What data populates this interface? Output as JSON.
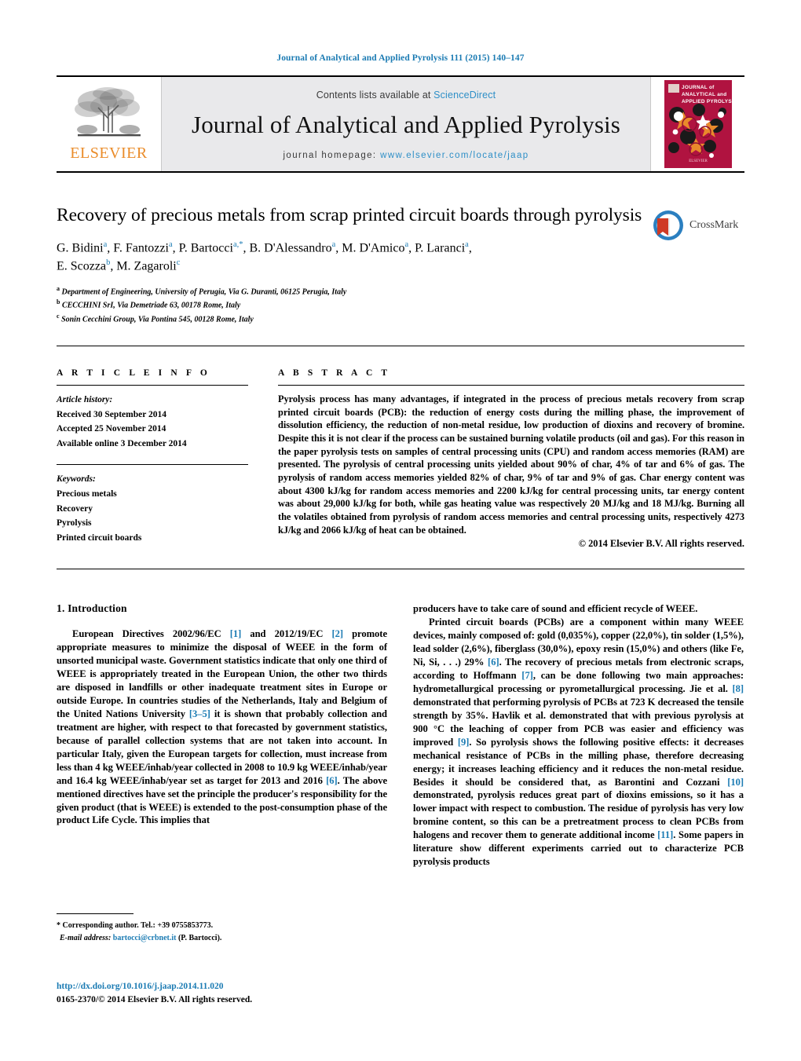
{
  "running_head": "Journal of Analytical and Applied Pyrolysis 111 (2015) 140–147",
  "masthead": {
    "publisher_logo_text": "ELSEVIER",
    "contents_prefix": "Contents lists available at ",
    "contents_link": "ScienceDirect",
    "journal_name": "Journal of Analytical and Applied Pyrolysis",
    "homepage_prefix": "journal homepage: ",
    "homepage_url": "www.elsevier.com/locate/jaap",
    "cover_title_line1": "JOURNAL of",
    "cover_title_line2": "ANALYTICAL and",
    "cover_title_line3": "APPLIED PYROLYSIS",
    "cover_footer": "ELSEVIER"
  },
  "article": {
    "title": "Recovery of precious metals from scrap printed circuit boards through pyrolysis",
    "authors_line1": "G. Bidini<sup>a</sup>, F. Fantozzi<sup>a</sup>, P. Bartocci<sup>a,*</sup>, B. D'Alessandro<sup>a</sup>, M. D'Amico<sup>a</sup>, P. Laranci<sup>a</sup>,",
    "authors_line2": "E. Scozza<sup>b</sup>, M. Zagaroli<sup>c</sup>",
    "affiliations": [
      "<sup>a</sup> Department of Engineering, University of Perugia, Via G. Duranti, 06125 Perugia, Italy",
      "<sup>b</sup> CECCHINI SrI, Via Demetriade 63, 00178 Rome, Italy",
      "<sup>c</sup> Sonin Cecchini Group, Via Pontina 545, 00128 Rome, Italy"
    ],
    "crossmark_label": "CrossMark"
  },
  "article_info": {
    "heading": "A R T I C L E   I N F O",
    "history_label": "Article history:",
    "history": [
      "Received 30 September 2014",
      "Accepted 25 November 2014",
      "Available online 3 December 2014"
    ],
    "keywords_label": "Keywords:",
    "keywords": [
      "Precious metals",
      "Recovery",
      "Pyrolysis",
      "Printed circuit boards"
    ]
  },
  "abstract": {
    "heading": "A B S T R A C T",
    "text": "Pyrolysis process has many advantages, if integrated in the process of precious metals recovery from scrap printed circuit boards (PCB): the reduction of energy costs during the milling phase, the improvement of dissolution efficiency, the reduction of non-metal residue, low production of dioxins and recovery of bromine. Despite this it is not clear if the process can be sustained burning volatile products (oil and gas). For this reason in the paper pyrolysis tests on samples of central processing units (CPU) and random access memories (RAM) are presented. The pyrolysis of central processing units yielded about 90% of char, 4% of tar and 6% of gas. The pyrolysis of random access memories yielded 82% of char, 9% of tar and 9% of gas. Char energy content was about 4300 kJ/kg for random access memories and 2200 kJ/kg for central processing units, tar energy content was about 29,000 kJ/kg for both, while gas heating value was respectively 20 MJ/kg and 18 MJ/kg. Burning all the volatiles obtained from pyrolysis of random access memories and central processing units, respectively 4273 kJ/kg and 2066 kJ/kg of heat can be obtained.",
    "copyright": "© 2014 Elsevier B.V. All rights reserved."
  },
  "body": {
    "section_heading": "1.  Introduction",
    "left_paragraph_1": "European Directives 2002/96/EC <span class=\"ref\">[1]</span> and 2012/19/EC <span class=\"ref\">[2]</span> promote appropriate measures to minimize the disposal of WEEE in the form of unsorted municipal waste. Government statistics indicate that only one third of WEEE is appropriately treated in the European Union, the other two thirds are disposed in landfills or other inadequate treatment sites in Europe or outside Europe. In countries studies of the Netherlands, Italy and Belgium of the United Nations University <span class=\"ref\">[3–5]</span> it is shown that probably collection and treatment are higher, with respect to that forecasted by government statistics, because of parallel collection systems that are not taken into account. In particular Italy, given the European targets for collection, must increase from less than 4 kg WEEE/inhab/year collected in 2008 to 10.9 kg WEEE/inhab/year and 16.4 kg WEEE/inhab/year set as target for 2013 and 2016 <span class=\"ref\">[6]</span>. The above mentioned directives have set the principle the producer's responsibility for the given product (that is WEEE) is extended to the post-consumption phase of the product Life Cycle. This implies that",
    "right_paragraph_1": "producers have to take care of sound and efficient recycle of WEEE.",
    "right_paragraph_2": "Printed circuit boards (PCBs) are a component within many WEEE devices, mainly composed of: gold (0,035%), copper (22,0%), tin solder (1,5%), lead solder (2,6%), fiberglass (30,0%), epoxy resin (15,0%) and others (like Fe, Ni, Si, . . .) 29% <span class=\"ref\">[6]</span>. The recovery of precious metals from electronic scraps, according to Hoffmann <span class=\"ref\">[7]</span>, can be done following two main approaches: hydrometallurgical processing or pyrometallurgical processing. Jie et al. <span class=\"ref\">[8]</span> demonstrated that performing pyrolysis of PCBs at 723 K decreased the tensile strength by 35%. Havlik et al. demonstrated that with previous pyrolysis at 900 °C the leaching of copper from PCB was easier and efficiency was improved <span class=\"ref\">[9]</span>. So pyrolysis shows the following positive effects: it decreases mechanical resistance of PCBs in the milling phase, therefore decreasing energy; it increases leaching efficiency and it reduces the non-metal residue. Besides it should be considered that, as Barontini and Cozzani <span class=\"ref\">[10]</span> demonstrated, pyrolysis reduces great part of dioxins emissions, so it has a lower impact with respect to combustion. The residue of pyrolysis has very low bromine content, so this can be a pretreatment process to clean PCBs from halogens and recover them to generate additional income <span class=\"ref\">[11]</span>. Some papers in literature show different experiments carried out to characterize PCB pyrolysis products"
  },
  "footnote": {
    "corresponding": "*  Corresponding author. Tel.: +39 0755853773.",
    "email_label": "E-mail address:",
    "email": "bartocci@crbnet.it",
    "email_suffix": " (P. Bartocci)."
  },
  "bottom": {
    "doi": "http://dx.doi.org/10.1016/j.jaap.2014.11.020",
    "issn": "0165-2370/© 2014 Elsevier B.V. All rights reserved."
  },
  "colors": {
    "link_blue": "#1b7bb3",
    "sciencedirect_blue": "#2e8fc7",
    "elsevier_orange": "#ea8c2a",
    "cover_red": "#b01340",
    "crossmark_blue": "#2b7fc0",
    "crossmark_red": "#cf3a25"
  }
}
